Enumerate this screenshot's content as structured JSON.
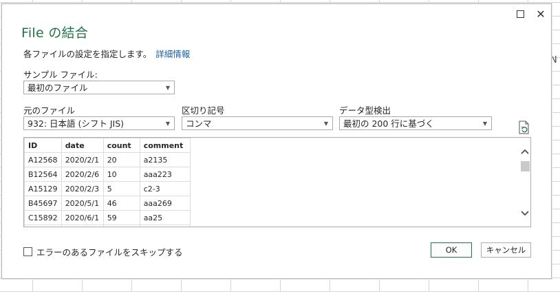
{
  "background": {
    "column_letter": "N"
  },
  "dialog": {
    "title": "File の結合",
    "subtitle": "各ファイルの設定を指定します。",
    "learn_more": "詳細情報",
    "sample_file": {
      "label": "サンプル ファイル:",
      "value": "最初のファイル"
    },
    "origin": {
      "label": "元のファイル",
      "value": "932: 日本語 (シフト JIS)"
    },
    "delimiter": {
      "label": "区切り記号",
      "value": "コンマ"
    },
    "data_type_detection": {
      "label": "データ型検出",
      "value": "最初の 200 行に基づく"
    },
    "preview": {
      "columns": [
        "ID",
        "date",
        "count",
        "comment"
      ],
      "rows": [
        [
          "A12568",
          "2020/2/1",
          "20",
          "a2135"
        ],
        [
          "B12564",
          "2020/2/6",
          "10",
          "aaa223"
        ],
        [
          "A15129",
          "2020/2/3",
          "5",
          "c2-3"
        ],
        [
          "B45697",
          "2020/5/1",
          "46",
          "aaa269"
        ],
        [
          "C15892",
          "2020/6/1",
          "59",
          "aa25"
        ],
        [
          "",
          "",
          "",
          ""
        ]
      ]
    },
    "skip_errors": {
      "label": "エラーのあるファイルをスキップする",
      "checked": false
    },
    "ok_label": "OK",
    "cancel_label": "キャンセル"
  },
  "icons": {
    "maximize": "maximize-icon",
    "close": "close-icon",
    "refresh": "refresh-icon"
  },
  "colors": {
    "title": "#217346",
    "link": "#1a5c9e"
  }
}
